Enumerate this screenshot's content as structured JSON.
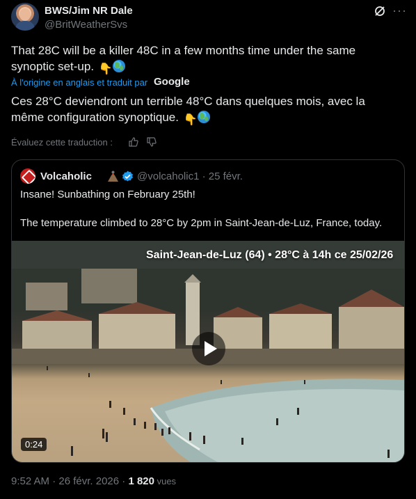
{
  "author": {
    "name": "BWS/Jim NR Dale",
    "handle": "@BritWeatherSvs"
  },
  "tweet": {
    "text": "That 28C will be a killer 48C in a few months time under the same synoptic set-up.",
    "emojis": [
      "pointing-down-icon",
      "globe-icon"
    ],
    "translation_notice": "À l'origine en anglais et traduit par",
    "translator": "Google",
    "translated_text": "Ces 28°C deviendront un terrible 48°C dans quelques mois, avec la même configuration synoptique.",
    "rate_label": "Évaluez cette traduction :"
  },
  "quote": {
    "name": "Volcaholic",
    "handle_date": "@volcaholic1 · 25 févr.",
    "text1": "Insane! Sunbathing on February 25th!",
    "text2": "The temperature climbed to 28°C by 2pm in Saint-Jean-de-Luz, France, today.",
    "video": {
      "overlay": "Saint-Jean-de-Luz (64) • 28°C à 14h ce 25/02/26",
      "duration": "0:24"
    }
  },
  "footer": {
    "timestamp": "9:52 AM · 26 févr. 2026 · ",
    "views": "1 820",
    "views_label": " vues"
  },
  "colors": {
    "background": "#000000",
    "text": "#e7e9ea",
    "muted": "#71767b",
    "link": "#1d9bf0",
    "border": "#2f3336",
    "verified": "#1d9bf0"
  }
}
